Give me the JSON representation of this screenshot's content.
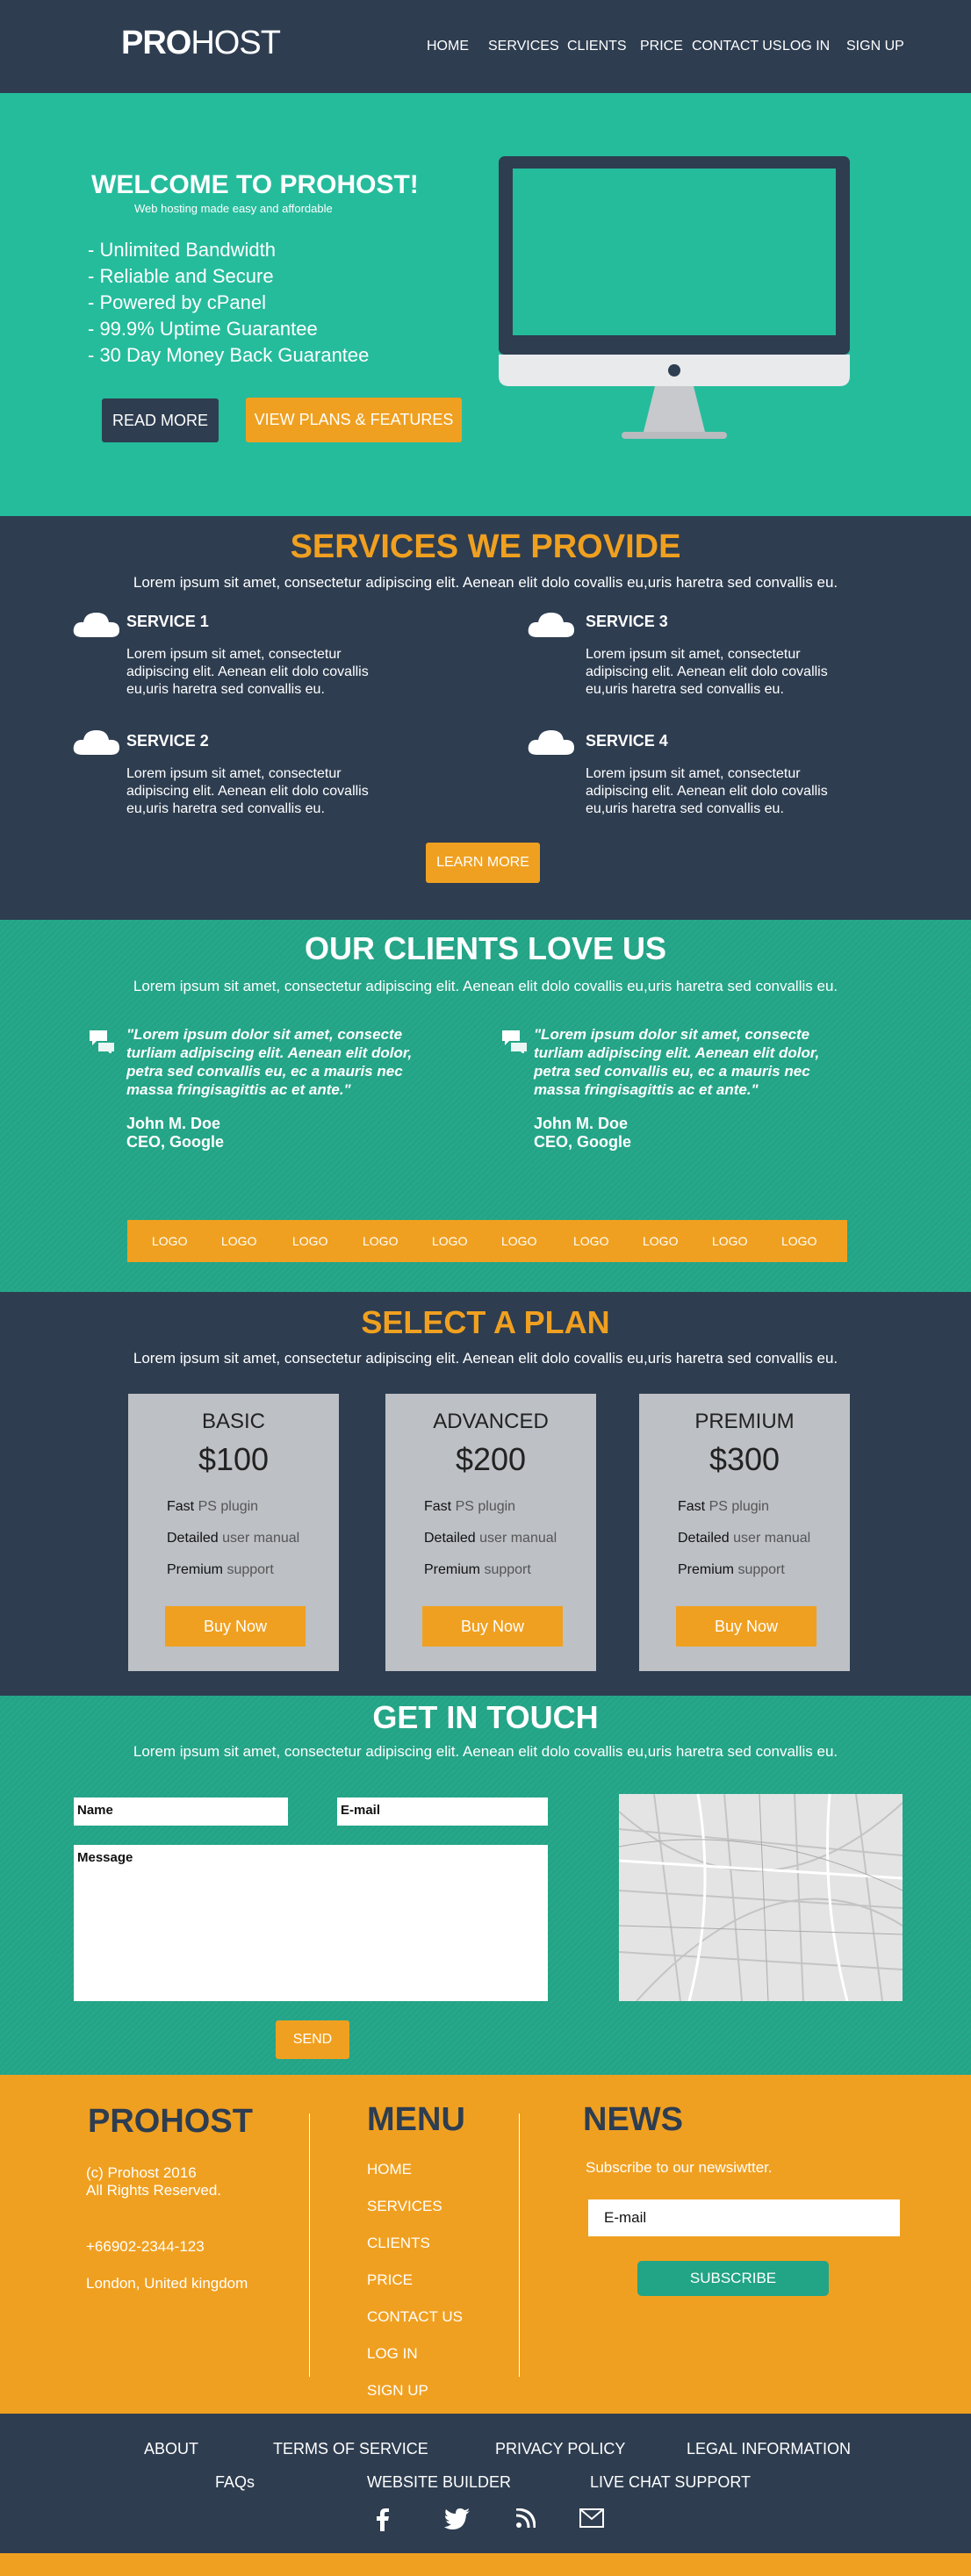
{
  "header": {
    "logo_bold": "PRO",
    "logo_thin": "HOST",
    "nav": [
      "HOME",
      "SERVICES",
      "CLIENTS",
      "PRICE",
      "CONTACT US",
      "LOG IN",
      "SIGN UP"
    ]
  },
  "hero": {
    "title": "WELCOME TO PROHOST!",
    "subtitle": "Web hosting made easy and affordable",
    "features": [
      "- Unlimited Bandwidth",
      "- Reliable and Secure",
      "- Powered by cPanel",
      "- 99.9% Uptime Guarantee",
      "- 30 Day Money Back Guarantee"
    ],
    "read_more": "READ MORE",
    "view_plans": "VIEW PLANS & FEATURES"
  },
  "services": {
    "title": "SERVICES WE PROVIDE",
    "desc": "Lorem ipsum sit amet, consectetur adipiscing elit. Aenean elit dolo covallis eu,uris haretra sed convallis eu.",
    "items": [
      {
        "name": "SERVICE 1",
        "text": "Lorem ipsum sit amet, consectetur adipiscing elit. Aenean elit dolo covallis eu,uris haretra sed convallis eu."
      },
      {
        "name": "SERVICE 2",
        "text": "Lorem ipsum sit amet, consectetur adipiscing elit. Aenean elit dolo covallis eu,uris haretra sed convallis eu."
      },
      {
        "name": "SERVICE 3",
        "text": "Lorem ipsum sit amet, consectetur adipiscing elit. Aenean elit dolo covallis eu,uris haretra sed convallis eu."
      },
      {
        "name": "SERVICE 4",
        "text": "Lorem ipsum sit amet, consectetur adipiscing elit. Aenean elit dolo covallis eu,uris haretra sed convallis eu."
      }
    ],
    "learn_more": "LEARN MORE"
  },
  "clients": {
    "title": "OUR CLIENTS LOVE US",
    "desc": "Lorem ipsum sit amet, consectetur adipiscing elit. Aenean elit dolo covallis eu,uris haretra sed convallis eu.",
    "testimonials": [
      {
        "quote": "\"Lorem ipsum dolor sit amet, consecte turliam adipiscing elit. Aenean elit dolor, petra sed convallis eu, ec a mauris nec massa fringisagittis ac et ante.\"",
        "name": "John M. Doe",
        "role": "CEO, Google"
      },
      {
        "quote": "\"Lorem ipsum dolor sit amet, consecte turliam adipiscing elit. Aenean elit dolor, petra sed convallis eu, ec a mauris nec massa fringisagittis ac et ante.\"",
        "name": "John M. Doe",
        "role": "CEO, Google"
      }
    ],
    "logos": [
      "LOGO",
      "LOGO",
      "LOGO",
      "LOGO",
      "LOGO",
      "LOGO",
      "LOGO",
      "LOGO",
      "LOGO",
      "LOGO"
    ]
  },
  "plans": {
    "title": "SELECT A PLAN",
    "desc": "Lorem ipsum sit amet, consectetur adipiscing elit. Aenean elit dolo covallis eu,uris haretra sed convallis eu.",
    "items": [
      {
        "name": "BASIC",
        "price": "$100",
        "f1a": "Fast",
        "f1b": " PS plugin",
        "f2a": "Detailed",
        "f2b": " user manual",
        "f3a": "Premium",
        "f3b": " support",
        "buy": "Buy Now"
      },
      {
        "name": "ADVANCED",
        "price": "$200",
        "f1a": "Fast",
        "f1b": " PS plugin",
        "f2a": "Detailed",
        "f2b": " user manual",
        "f3a": "Premium",
        "f3b": " support",
        "buy": "Buy Now"
      },
      {
        "name": "PREMIUM",
        "price": "$300",
        "f1a": "Fast",
        "f1b": " PS plugin",
        "f2a": "Detailed",
        "f2b": " user manual",
        "f3a": "Premium",
        "f3b": " support",
        "buy": "Buy Now"
      }
    ]
  },
  "contact": {
    "title": "GET IN TOUCH",
    "desc": "Lorem ipsum sit amet, consectetur adipiscing elit. Aenean elit dolo covallis eu,uris haretra sed convallis eu.",
    "name_label": "Name",
    "email_label": "E-mail",
    "message_label": "Message",
    "send": "SEND"
  },
  "footer": {
    "brand": "PROHOST",
    "copyright1": "(c) Prohost 2016",
    "copyright2": "All Rights Reserved.",
    "phone": "+66902-2344-123",
    "address": "London, United kingdom",
    "menu_title": "MENU",
    "menu": [
      "HOME",
      "SERVICES",
      "CLIENTS",
      "PRICE",
      "CONTACT US",
      "LOG IN",
      "SIGN UP"
    ],
    "news_title": "NEWS",
    "news_text": "Subscribe to our newsiwtter.",
    "email_placeholder": "E-mail",
    "subscribe": "SUBSCRIBE"
  },
  "bottom": {
    "links_row1": [
      "ABOUT",
      "TERMS OF SERVICE",
      "PRIVACY POLICY",
      "LEGAL INFORMATION"
    ],
    "links_row2": [
      "FAQs",
      "WEBSITE BUILDER",
      "LIVE CHAT SUPPORT"
    ],
    "social_icons": [
      "facebook-icon",
      "twitter-icon",
      "rss-icon",
      "mail-icon"
    ]
  },
  "colors": {
    "navy": "#2e3d50",
    "teal": "#25bc9c",
    "teal_dark": "#22a486",
    "orange": "#f0a020",
    "plan_card": "#bdc0c5"
  }
}
